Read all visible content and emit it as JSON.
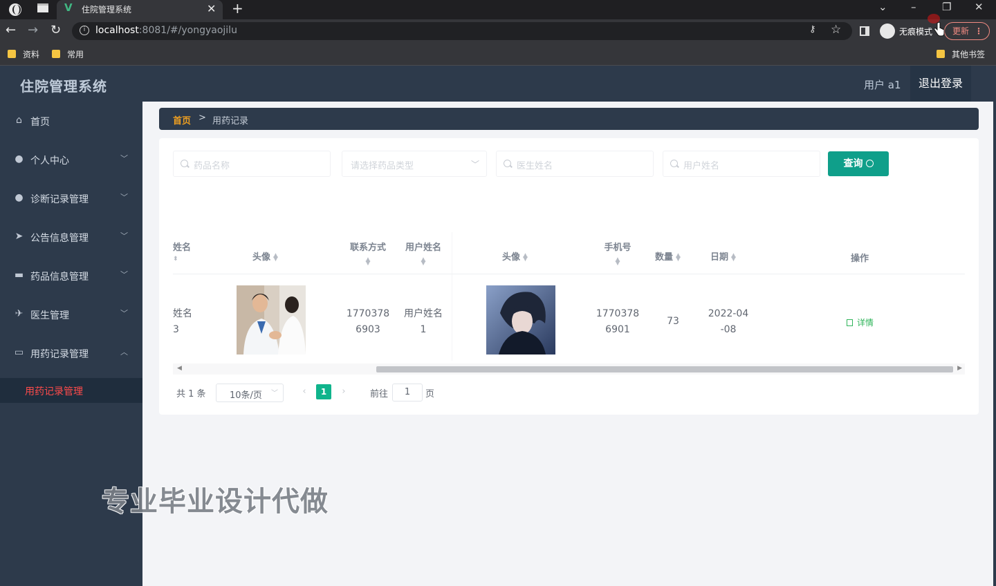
{
  "browser": {
    "tab_title": "住院管理系统",
    "url_host": "localhost",
    "url_path": ":8081/#/yongyaojilu",
    "incognito_label": "无痕模式",
    "update_label": "更新",
    "bookmarks": [
      "资料",
      "常用"
    ],
    "other_bookmarks": "其他书签"
  },
  "header": {
    "title": "住院管理系统",
    "user": "用户 a1",
    "logout": "退出登录"
  },
  "sidebar": {
    "items": [
      {
        "label": "首页",
        "icon": "home-icon"
      },
      {
        "label": "个人中心",
        "icon": "user-icon"
      },
      {
        "label": "诊断记录管理",
        "icon": "user-icon"
      },
      {
        "label": "公告信息管理",
        "icon": "send-icon"
      },
      {
        "label": "药品信息管理",
        "icon": "briefcase-icon"
      },
      {
        "label": "医生管理",
        "icon": "paper-plane-icon"
      },
      {
        "label": "用药记录管理",
        "icon": "chat-icon"
      }
    ],
    "active_sub": "用药记录管理"
  },
  "breadcrumb": {
    "home": "首页",
    "separator": ">",
    "current": "用药记录"
  },
  "search": {
    "drug_name_placeholder": "药品名称",
    "drug_type_placeholder": "请选择药品类型",
    "doctor_name_placeholder": "医生姓名",
    "user_name_placeholder": "用户姓名",
    "query_label": "查询"
  },
  "table": {
    "columns": {
      "name": "姓名",
      "avatar1": "头像",
      "contact": "联系方式",
      "username": "用户姓名",
      "avatar2": "头像",
      "phone": "手机号",
      "quantity": "数量",
      "date": "日期",
      "actions": "操作"
    },
    "rows": [
      {
        "name_l1": "姓名",
        "name_l2": "3",
        "contact_l1": "1770378",
        "contact_l2": "6903",
        "username_l1": "用户姓名",
        "username_l2": "1",
        "phone_l1": "1770378",
        "phone_l2": "6901",
        "quantity": "73",
        "date_l1": "2022-04",
        "date_l2": "-08",
        "detail": "详情"
      }
    ]
  },
  "pagination": {
    "total": "共 1 条",
    "page_size": "10条/页",
    "current": "1",
    "goto": "前往",
    "goto_value": "1",
    "page_suffix": "页"
  },
  "watermark": "专业毕业设计代做",
  "colors": {
    "sidebar_bg": "#2d3a4b",
    "accent_primary": "#0f9f8a",
    "active_menu": "#ff4b4b",
    "breadcrumb_home": "#f0a020"
  }
}
